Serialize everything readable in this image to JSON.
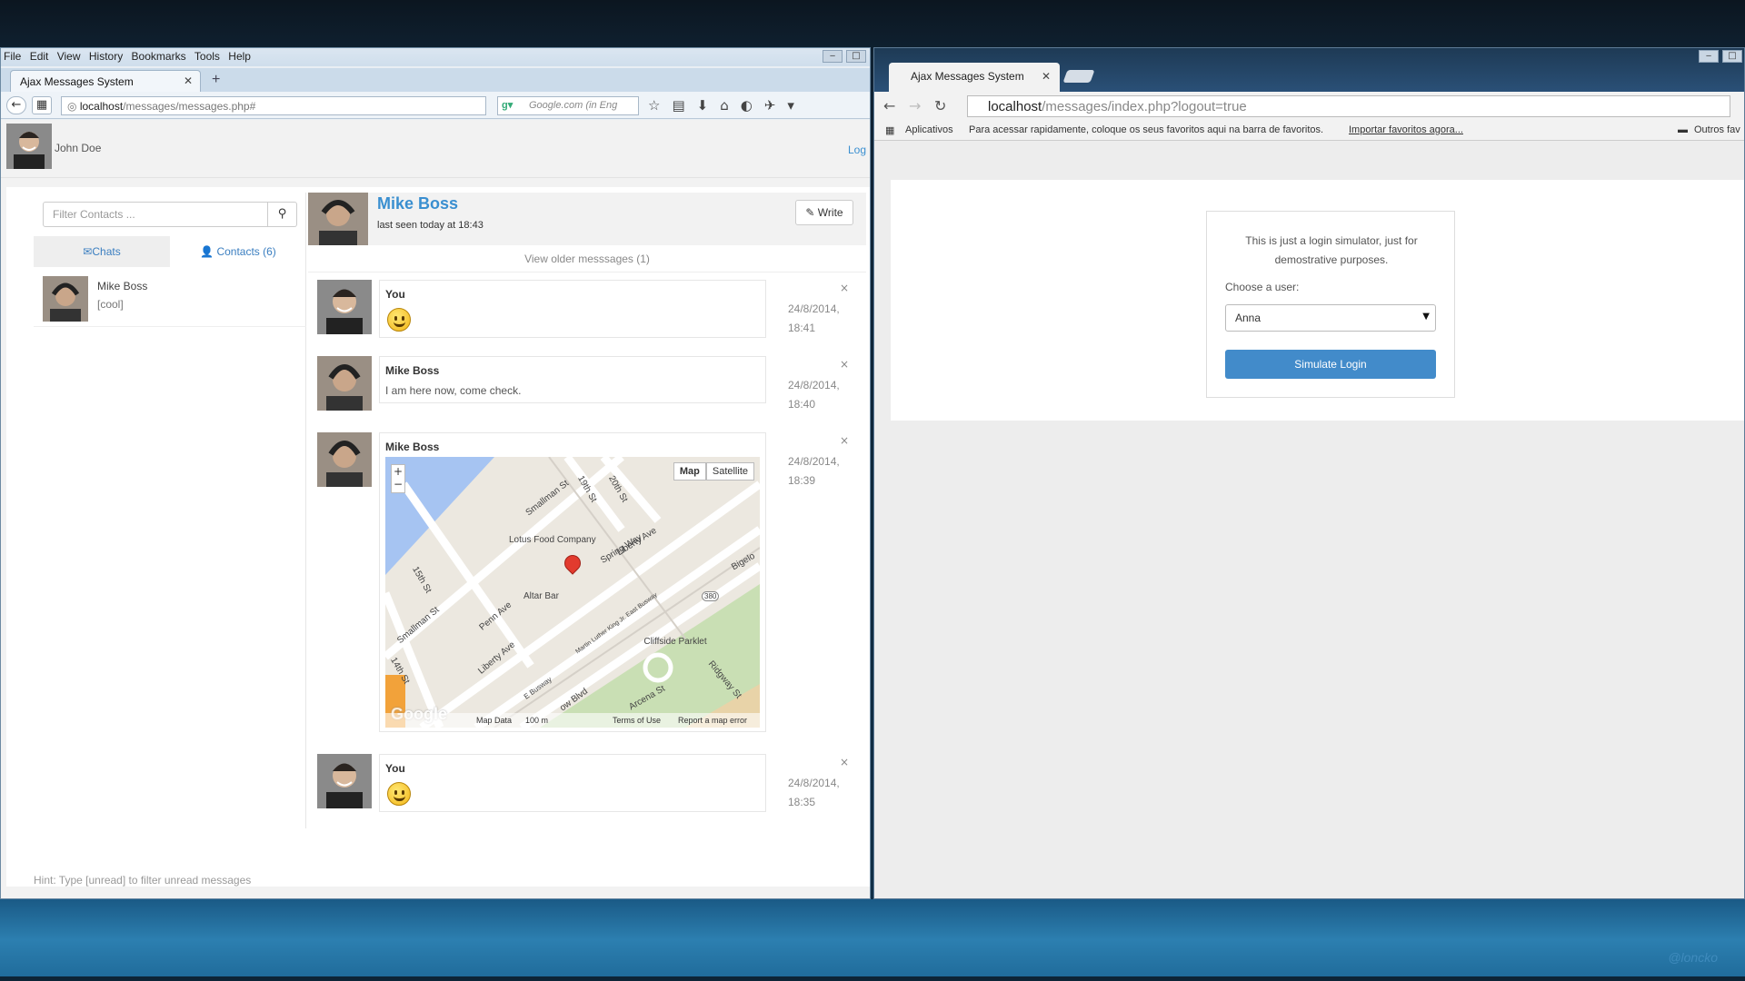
{
  "firefox": {
    "menu": [
      "File",
      "Edit",
      "View",
      "History",
      "Bookmarks",
      "Tools",
      "Help"
    ],
    "tab_title": "Ajax Messages System",
    "url_host": "localhost",
    "url_path": "/messages/messages.php#",
    "search_placeholder": "Google.com (in Eng"
  },
  "app": {
    "user_name": "John Doe",
    "logout_label": "Log",
    "filter_placeholder": "Filter Contacts ...",
    "tabs": {
      "chats": "✉Chats",
      "contacts": "👤 Contacts (6)"
    },
    "contacts": [
      {
        "name": "Mike Boss",
        "last_message": "[cool]"
      }
    ],
    "hint": "Hint: Type [unread] to filter unread messages",
    "conversation": {
      "name": "Mike Boss",
      "last_seen": "last seen today at 18:43",
      "write_label": "✎ Write",
      "older_label": "View older messsages (1)",
      "messages": [
        {
          "sender": "You",
          "type": "emoji",
          "date": "24/8/2014,",
          "time": "18:41"
        },
        {
          "sender": "Mike Boss",
          "text": "I am here now, come check.",
          "date": "24/8/2014,",
          "time": "18:40"
        },
        {
          "sender": "Mike Boss",
          "type": "map",
          "date": "24/8/2014,",
          "time": "18:39"
        },
        {
          "sender": "You",
          "type": "emoji",
          "date": "24/8/2014,",
          "time": "18:35"
        }
      ]
    },
    "map": {
      "map_btn": "Map",
      "satellite_btn": "Satellite",
      "labels": [
        "Smallman St",
        "19th St",
        "20th St",
        "Lotus Food Company",
        "Spring Way",
        "Liberty Ave",
        "Altar Bar",
        "15th St",
        "Smallman St",
        "Penn Ave",
        "Liberty Ave",
        "14th St",
        "Cliffside Parklet",
        "Ridgway St",
        "Arcena St",
        "Bigelo",
        "380",
        "Martin Luther King Jr. East Busway",
        "E Busway",
        "ow Blvd"
      ],
      "footer": [
        "Map Data",
        "100 m",
        "Terms of Use",
        "Report a map error"
      ],
      "logo": "Google"
    }
  },
  "chrome": {
    "tab_title": "Ajax Messages System",
    "url_host": "localhost",
    "url_path": "/messages/index.php?logout=true",
    "bookmarks_apps": "Aplicativos",
    "bookmarks_text": "Para acessar rapidamente, coloque os seus favoritos aqui na barra de favoritos.",
    "bookmarks_import": "Importar favoritos agora...",
    "bookmarks_other": "Outros fav",
    "login": {
      "intro": "This is just a login simulator, just for demostrative purposes.",
      "choose_label": "Choose a user:",
      "selected_user": "Anna",
      "button_label": "Simulate Login"
    }
  },
  "watermark": "@loncko"
}
